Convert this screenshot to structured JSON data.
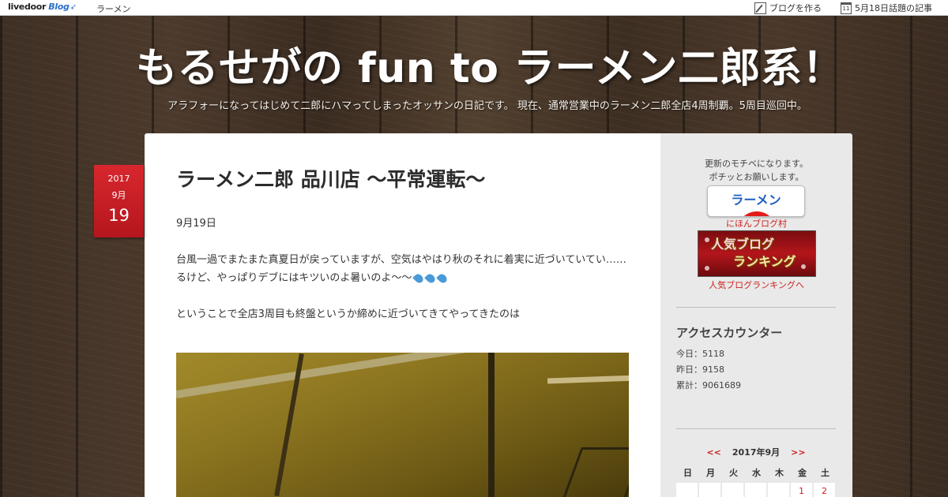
{
  "topbar": {
    "brand": "livedoor",
    "brand_blog": "Blog",
    "category": "ラーメン",
    "create_blog": "ブログを作る",
    "topics_icon_day": "11",
    "topics": "5月18日話題の記事"
  },
  "header": {
    "title": "もるせがの fun to ラーメン二郎系！",
    "description": "アラフォーになってはじめて二郎にハマってしまったオッサンの日記です。 現在、通常営業中のラーメン二郎全店4周制覇。5周目巡回中。"
  },
  "post": {
    "date": {
      "year": "2017",
      "month": "9月",
      "day": "19"
    },
    "title": "ラーメン二郎 品川店 〜平常運転〜",
    "paragraphs": [
      "9月19日",
      "台風一過でまたまた真夏日が戻っていますが、空気はやはり秋のそれに着実に近づいていてい…… るけど、やっぱりデブにはキツいのよ暑いのよ〜〜",
      "ということで全店3周目も終盤というか締めに近づいてきてやってきたのは"
    ],
    "emoji": "sweat-drops-icon"
  },
  "sidebar": {
    "note_line1": "更新のモチベになります。",
    "note_line2": "ポチッとお願いします。",
    "ramen_banner": "ラーメン",
    "nihon_link": "にほんブログ村",
    "rank_banner_line1": "人気ブログ",
    "rank_banner_line2": "ランキング",
    "rank_link": "人気ブログランキングへ",
    "access_title": "アクセスカウンター",
    "access": {
      "today": "今日：5118",
      "yesterday": "昨日：9158",
      "total": "累計：9061689"
    },
    "calendar": {
      "prev": "<<",
      "month": "2017年9月",
      "next": ">>",
      "weekdays": [
        "日",
        "月",
        "火",
        "水",
        "木",
        "金",
        "土"
      ],
      "first_row": [
        "",
        "",
        "",
        "",
        "",
        "1",
        "2"
      ]
    }
  },
  "colors": {
    "accent_red": "#cc1f1f",
    "date_tab": "#c81e25",
    "link_blue": "#1f5fc0"
  }
}
